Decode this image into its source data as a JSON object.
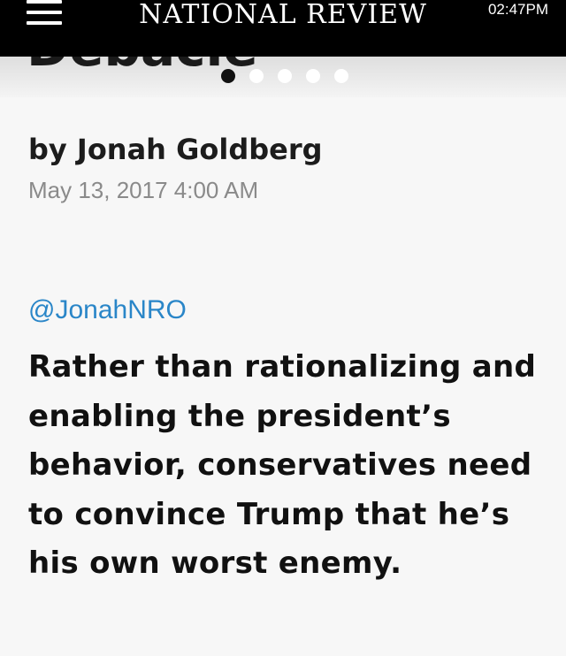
{
  "header": {
    "brand": "NATIONAL REVIEW",
    "time": "02:47PM",
    "menu_icon": "hamburger-menu-icon"
  },
  "hero": {
    "title_fragment": "Debacle",
    "carousel": {
      "count": 5,
      "active_index": 0
    }
  },
  "article": {
    "byline": "by Jonah Goldberg",
    "date": "May 13, 2017 4:00 AM",
    "twitter_handle": "@JonahNRO",
    "pull_quote": "Rather than rationalizing and enabling the president’s behavior, conservatives need to convince Trump that he’s his own worst enemy."
  },
  "colors": {
    "topbar": "#000000",
    "link": "#2a86c8",
    "date": "#8a8a8a"
  }
}
